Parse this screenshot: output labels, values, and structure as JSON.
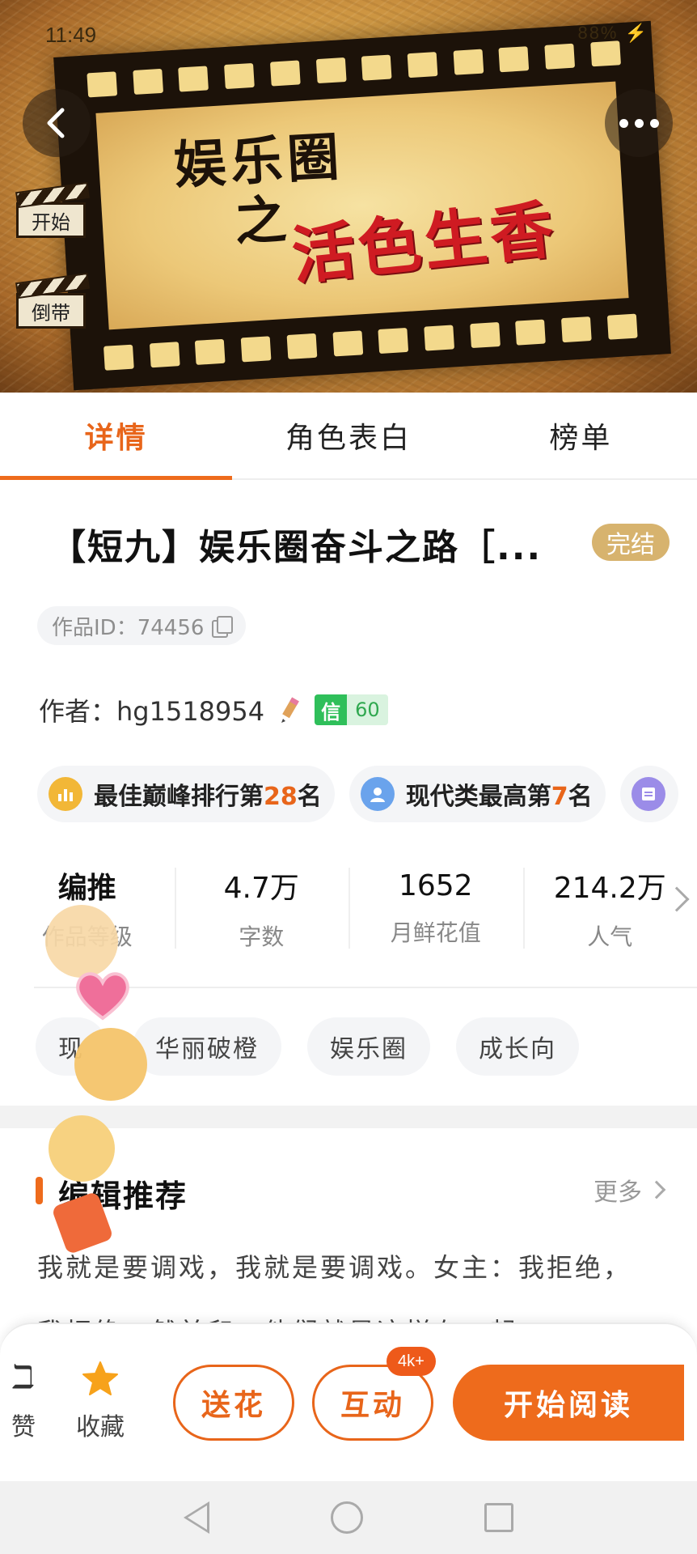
{
  "status_bar": {
    "time": "11:49",
    "right": "88% ⚡"
  },
  "cover": {
    "art_line1": "娱乐圈",
    "art_line2": "之",
    "art_line3": "活色生香",
    "clap_start": "开始",
    "clap_rewind": "倒带"
  },
  "tabs": [
    {
      "label": "详情",
      "active": true
    },
    {
      "label": "角色表白",
      "active": false
    },
    {
      "label": "榜单",
      "active": false
    }
  ],
  "book": {
    "title": "【短九】娱乐圈奋斗之路［...",
    "status": "完结",
    "work_id": "作品ID：74456",
    "author_label": "作者：hg1518954",
    "credit_badge": {
      "left": "信",
      "right": "60"
    }
  },
  "ranks": [
    {
      "prefix": "最佳巅峰排行第",
      "num": "28",
      "suffix": "名",
      "icon": "chart-icon"
    },
    {
      "prefix": "现代类最高第",
      "num": "7",
      "suffix": "名",
      "icon": "person-icon"
    },
    {
      "prefix": "",
      "num": "",
      "suffix": "",
      "icon": "book-icon"
    }
  ],
  "stats": [
    {
      "value": "编推",
      "label": "作品等级"
    },
    {
      "value": "4.7万",
      "label": "字数"
    },
    {
      "value": "1652",
      "label": "月鲜花值"
    },
    {
      "value": "214.2万",
      "label": "人气"
    }
  ],
  "tags": [
    "现",
    "华丽破橙",
    "娱乐圈",
    "成长向"
  ],
  "editor_rec": {
    "title": "编辑推荐",
    "more": "更多",
    "text": "我就是要调戏，我就是要调戏。女主：我拒绝，我拒绝，然并卵，他们就是这样在一起"
  },
  "action_bar": {
    "like_label": "赞",
    "fav_label": "收藏",
    "flower": "送花",
    "interact": "互动",
    "interact_badge": "4k+",
    "read": "开始阅读"
  },
  "colors": {
    "accent": "#ee6b1c",
    "status_tag": "#d7b36e",
    "credit_green": "#2fbf5a"
  }
}
